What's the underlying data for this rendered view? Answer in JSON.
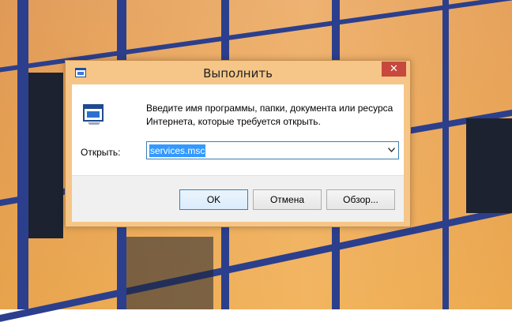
{
  "dialog": {
    "title": "Выполнить",
    "close_label": "✕",
    "description": "Введите имя программы, папки, документа или ресурса Интернета, которые требуется открыть.",
    "open_label": "Открыть:",
    "open_value": "services.msc",
    "buttons": {
      "ok": "OK",
      "cancel": "Отмена",
      "browse": "Обзор..."
    }
  },
  "icons": {
    "title": "run-icon",
    "main": "run-icon",
    "dropdown": "chevron-down-icon"
  },
  "colors": {
    "title_bar": "#f5c687",
    "close_button": "#c7483d",
    "selection": "#3399ff",
    "focus_border": "#3c7fb1"
  }
}
